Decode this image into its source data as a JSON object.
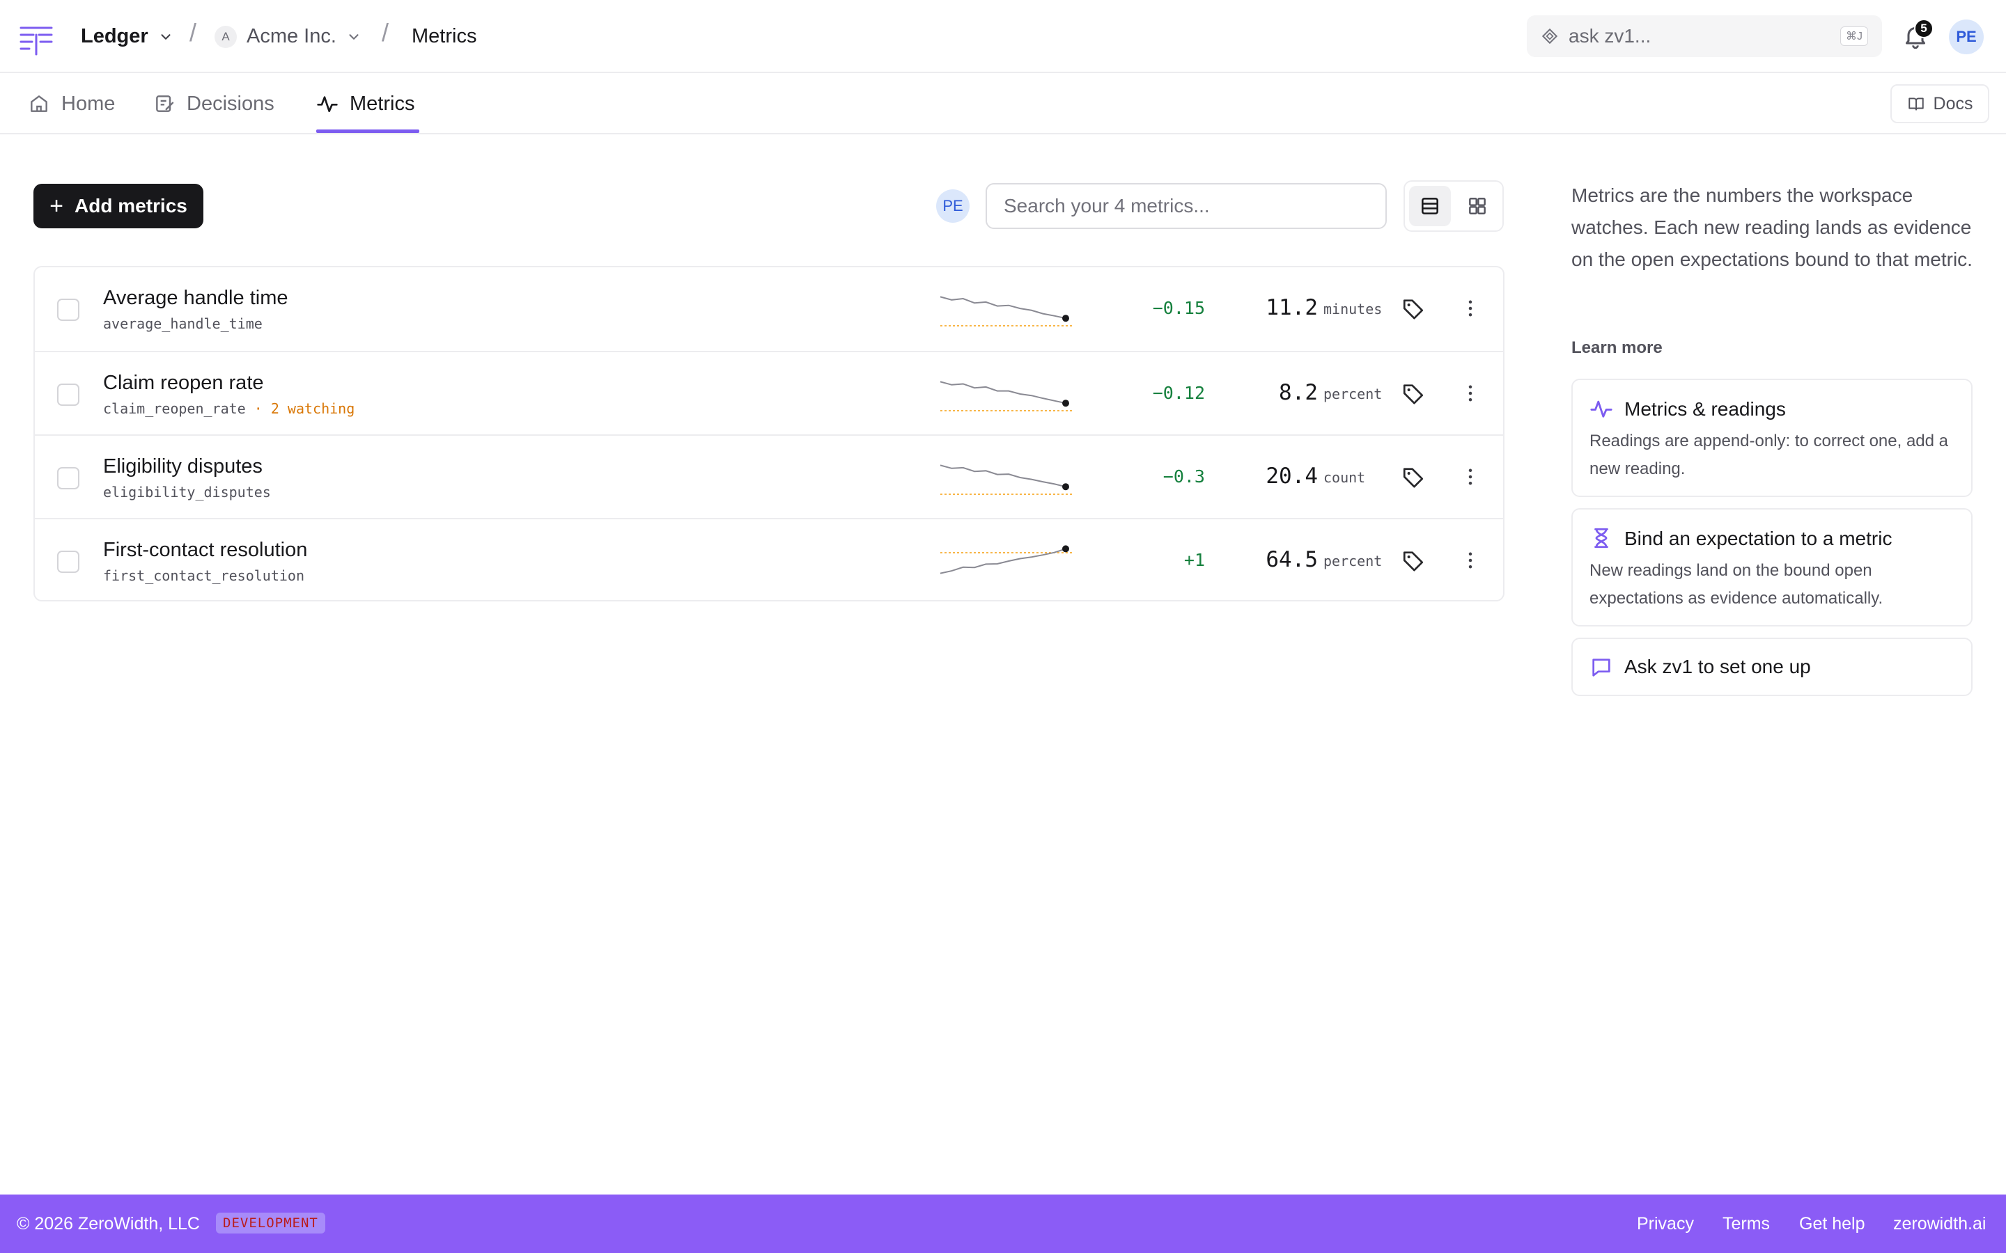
{
  "header": {
    "workspace": "Ledger",
    "org_initial": "A",
    "org": "Acme Inc.",
    "page": "Metrics",
    "ask_placeholder": "ask zv1...",
    "ask_shortcut": "⌘J",
    "notifications": "5",
    "avatar": "PE"
  },
  "nav": {
    "tabs": [
      {
        "label": "Home",
        "icon": "home-icon"
      },
      {
        "label": "Decisions",
        "icon": "edit-note-icon"
      },
      {
        "label": "Metrics",
        "icon": "activity-icon",
        "active": true
      }
    ],
    "docs_label": "Docs"
  },
  "toolbar": {
    "add_label": "Add metrics",
    "owner_avatar": "PE",
    "search_placeholder": "Search your 4 metrics..."
  },
  "metrics": [
    {
      "name": "Average handle time",
      "slug": "average_handle_time",
      "watching": "",
      "delta": "−0.15",
      "value": "11.2",
      "unit": "minutes",
      "trend": [
        9,
        8,
        8.4,
        7,
        7.3,
        6,
        6.2,
        5.2,
        4.6,
        3.5,
        2.8,
        2
      ]
    },
    {
      "name": "Claim reopen rate",
      "slug": "claim_reopen_rate",
      "watching": " · 2 watching",
      "delta": "−0.12",
      "value": "8.2",
      "unit": "percent",
      "trend": [
        9,
        8,
        8.3,
        7,
        7.3,
        6,
        6,
        5,
        4.5,
        3.6,
        2.8,
        2
      ]
    },
    {
      "name": "Eligibility disputes",
      "slug": "eligibility_disputes",
      "watching": "",
      "delta": "−0.3",
      "value": "20.4",
      "unit": "count",
      "trend": [
        9,
        8,
        8.2,
        7,
        7.2,
        6,
        6.1,
        5,
        4.4,
        3.6,
        2.9,
        2
      ]
    },
    {
      "name": "First-contact resolution",
      "slug": "first_contact_resolution",
      "watching": "",
      "delta": "+1",
      "value": "64.5",
      "unit": "percent",
      "trend": [
        1,
        1.8,
        3,
        2.9,
        4,
        4.1,
        5,
        5.8,
        6.3,
        7,
        7.8,
        9
      ]
    }
  ],
  "sidebar": {
    "intro": "Metrics are the numbers the workspace watches. Each new reading lands as evidence on the open expectations bound to that metric.",
    "learn_more": "Learn more",
    "cards": [
      {
        "title": "Metrics & readings",
        "desc": "Readings are append-only: to correct one, add a new reading.",
        "icon": "activity-icon"
      },
      {
        "title": "Bind an expectation to a metric",
        "desc": "New readings land on the bound open expectations as evidence automatically.",
        "icon": "hourglass-icon"
      },
      {
        "title": "Ask zv1 to set one up",
        "desc": "",
        "icon": "chat-icon"
      }
    ]
  },
  "footer": {
    "copyright": "© 2026 ZeroWidth, LLC",
    "env": "DEVELOPMENT",
    "links": [
      "Privacy",
      "Terms",
      "Get help",
      "zerowidth.ai"
    ]
  },
  "colors": {
    "accent": "#7c5cf0",
    "footer_bg": "#8b5cf6",
    "positive": "#15803d",
    "watching": "#d97706",
    "target_line": "#f59e0b"
  }
}
